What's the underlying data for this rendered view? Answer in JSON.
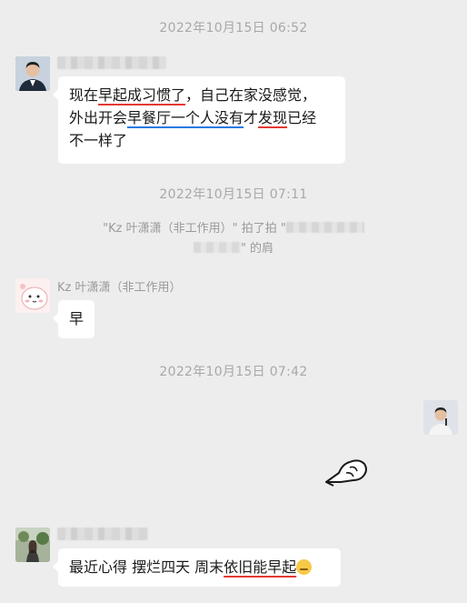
{
  "timestamps": [
    "2022年10月15日 06:52",
    "2022年10月15日 07:11",
    "2022年10月15日 07:42"
  ],
  "messages": [
    {
      "sender": "",
      "lines": [
        [
          "现在",
          "早起成习惯了",
          "，自己在家没感觉，"
        ],
        [
          "外出开会",
          "早餐厅一个人没有",
          "才",
          "发现",
          "已经"
        ],
        [
          "不一样了"
        ]
      ]
    },
    {
      "sender": "Kz 叶潇潇（非工作用）",
      "text": "早"
    },
    {
      "sender": "",
      "parts": [
        "最近心得 摆烂四天 周末",
        "依旧能早起"
      ]
    }
  ],
  "pat": {
    "line1_prefix": "\"Kz 叶潇潇（非工作用）\" 拍了拍 \"",
    "line2_suffix": "\" 的肩"
  },
  "icons": {
    "fist": "fist-bump-icon",
    "emoji": "thinking-face-icon"
  },
  "colors": {
    "background": "#ededed",
    "bubble": "#ffffff",
    "underline_red": "#e53935",
    "underline_blue": "#1e7be0"
  }
}
